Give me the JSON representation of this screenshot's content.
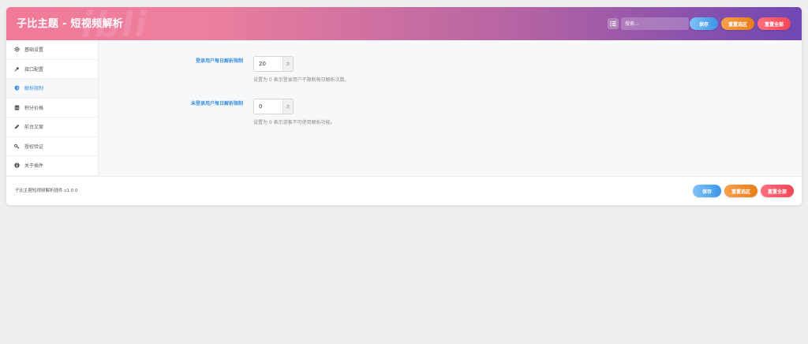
{
  "header": {
    "title": "子比主题 - 短视频解析",
    "watermark": "ibli",
    "search_placeholder": "搜索...",
    "buttons": {
      "save": "保存",
      "reset_section": "重置选区",
      "reset_all": "重置全部"
    }
  },
  "sidebar": {
    "items": [
      {
        "label": "基础设置",
        "icon": "gear-icon"
      },
      {
        "label": "接口配置",
        "icon": "plug-icon"
      },
      {
        "label": "解析限制",
        "icon": "shield-icon",
        "active": true
      },
      {
        "label": "积分价格",
        "icon": "database-icon"
      },
      {
        "label": "前台文案",
        "icon": "pencil-icon"
      },
      {
        "label": "授权验证",
        "icon": "key-icon"
      },
      {
        "label": "关于插件",
        "icon": "info-icon"
      }
    ]
  },
  "main": {
    "fields": [
      {
        "label": "登录用户每日解析限制",
        "value": "20",
        "unit": "次",
        "hint": "设置为 0 表示登录用户不限制每日解析次数。"
      },
      {
        "label": "未登录用户每日解析限制",
        "value": "0",
        "unit": "次",
        "hint": "设置为 0 表示游客不可使用解析功能。"
      }
    ]
  },
  "footer": {
    "version": "子比主题短视频解析插件 v1.0.0",
    "buttons": {
      "save": "保存",
      "reset_section": "重置选区",
      "reset_all": "重置全部"
    }
  },
  "colors": {
    "accent": "#3b8fdd",
    "header_gradient_start": "#f27a99",
    "header_gradient_end": "#6f47b4",
    "save": "#3b94e6",
    "reset_section": "#e77d1a",
    "reset_all": "#f04657"
  }
}
